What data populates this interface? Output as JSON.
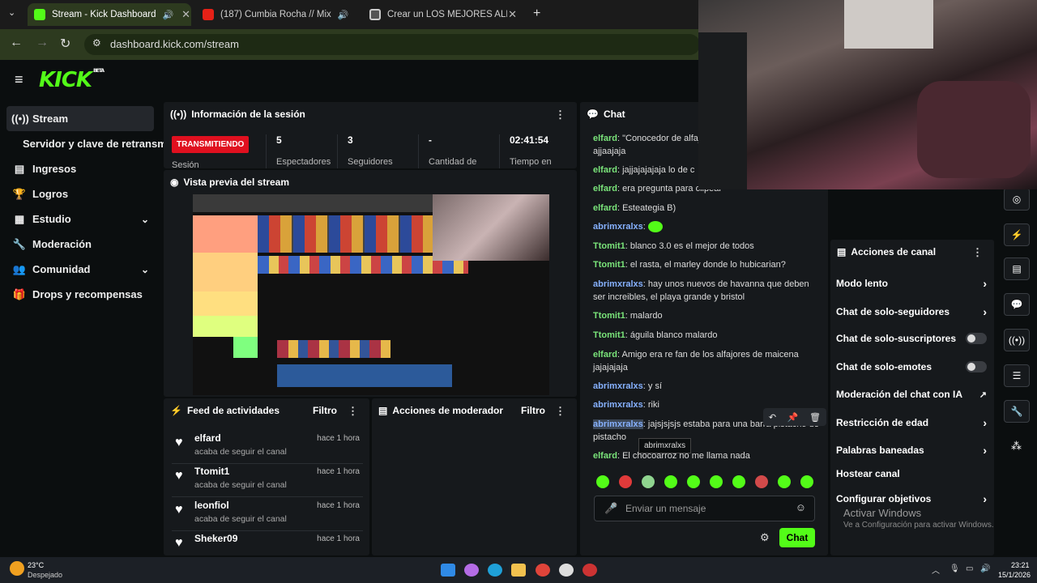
{
  "tabs": [
    {
      "label": "Stream - Kick Dashboard",
      "active": true,
      "favicon": "kick-icon"
    },
    {
      "label": "(187) Cumbia Rocha // Mix",
      "active": false,
      "favicon": "youtube-icon"
    },
    {
      "label": "Crear un LOS MEJORES ALFAJO",
      "active": false,
      "favicon": "tierlist-icon"
    }
  ],
  "url": "dashboard.kick.com/stream",
  "brand": {
    "logo": "KICK",
    "beta": "BETA",
    "accent": "#53fc18"
  },
  "sidebar": {
    "items": [
      {
        "label": "Stream",
        "icon": "broadcast-icon",
        "active": true
      },
      {
        "label": "Servidor y clave de retransmisión",
        "icon": "",
        "sub": true
      },
      {
        "label": "Ingresos",
        "icon": "chart-icon"
      },
      {
        "label": "Logros",
        "icon": "trophy-icon"
      },
      {
        "label": "Estudio",
        "icon": "layout-icon",
        "expand": true
      },
      {
        "label": "Moderación",
        "icon": "wrench-icon"
      },
      {
        "label": "Comunidad",
        "icon": "people-icon",
        "expand": true
      },
      {
        "label": "Drops y recompensas",
        "icon": "gift-icon"
      }
    ]
  },
  "session": {
    "title": "Información de la sesión",
    "status": "TRANSMITIENDO",
    "status_sub": "Sesión",
    "stats": [
      {
        "value": "5",
        "label": "Espectadores"
      },
      {
        "value": "3",
        "label": "Seguidores"
      },
      {
        "value": "-",
        "label": "Cantidad de"
      },
      {
        "value": "02:41:54",
        "label": "Tiempo en"
      }
    ]
  },
  "preview": {
    "title": "Vista previa del stream"
  },
  "feed": {
    "title": "Feed de actividades",
    "filter": "Filtro",
    "items": [
      {
        "name": "elfard",
        "action": "acaba de seguir el canal",
        "time": "hace 1 hora"
      },
      {
        "name": "Ttomit1",
        "action": "acaba de seguir el canal",
        "time": "hace 1 hora"
      },
      {
        "name": "leonfiol",
        "action": "acaba de seguir el canal",
        "time": "hace 1 hora"
      },
      {
        "name": "Sheker09",
        "action": "",
        "time": "hace 1 hora"
      }
    ]
  },
  "modactions": {
    "title": "Acciones de moderador",
    "filter": "Filtro"
  },
  "chat": {
    "title": "Chat",
    "placeholder": "Enviar un mensaje",
    "send": "Chat",
    "messages": [
      {
        "user": "elfard",
        "text": "\"Conocedor de alfaj",
        "text2": "ajjaajaja"
      },
      {
        "user": "elfard",
        "text": "jajjajajajaja lo de c"
      },
      {
        "user": "elfard",
        "text": "era pregunta para clipear"
      },
      {
        "user": "elfard",
        "text": "Esteategia B)"
      },
      {
        "user": "abrimxralxs",
        "text": "",
        "emote": true
      },
      {
        "user": "Ttomit1",
        "text": "blanco 3.0 es el mejor de todos"
      },
      {
        "user": "Ttomit1",
        "text": "el rasta, el marley donde lo hubicarian?"
      },
      {
        "user": "abrimxralxs",
        "text": "hay unos nuevos de havanna que deben",
        "text2": "ser increibles, el playa grande y bristol"
      },
      {
        "user": "Ttomit1",
        "text": "malardo"
      },
      {
        "user": "Ttomit1",
        "text": "águila blanco malardo"
      },
      {
        "user": "elfard",
        "text": "Amigo era re fan de los alfajores de maicena",
        "text2": "jajajajaja"
      },
      {
        "user": "abrimxralxs",
        "text": "y sí"
      },
      {
        "user": "abrimxralxs",
        "text": "riki"
      },
      {
        "user": "abrimxralxs",
        "text": "jajsjsjsjs estaba para una barra pistacho de",
        "text2": "pistacho"
      },
      {
        "user": "elfard",
        "text": "El chocoarroz no me llama nada"
      }
    ],
    "tooltip": "abrimxralxs"
  },
  "channel_actions": {
    "title": "Acciones de canal",
    "items": [
      {
        "label": "Modo lento",
        "type": "chevron"
      },
      {
        "label": "Chat de solo-seguidores",
        "type": "chevron"
      },
      {
        "label": "Chat de solo-suscriptores",
        "type": "toggle"
      },
      {
        "label": "Chat de solo-emotes",
        "type": "toggle"
      },
      {
        "label": "Moderación del chat con IA",
        "type": "external"
      },
      {
        "label": "Restricción de edad",
        "type": "chevron"
      },
      {
        "label": "Palabras baneadas",
        "type": "chevron"
      },
      {
        "label": "Hostear canal",
        "type": "none"
      },
      {
        "label": "Configurar objetivos",
        "type": "chevron"
      }
    ]
  },
  "watermark": {
    "line1": "Activar Windows",
    "line2": "Ve a Configuración para activar Windows."
  },
  "taskbar": {
    "temp": "23°C",
    "weather": "Despejado",
    "time": "23:21",
    "date": "15/1/2026"
  }
}
